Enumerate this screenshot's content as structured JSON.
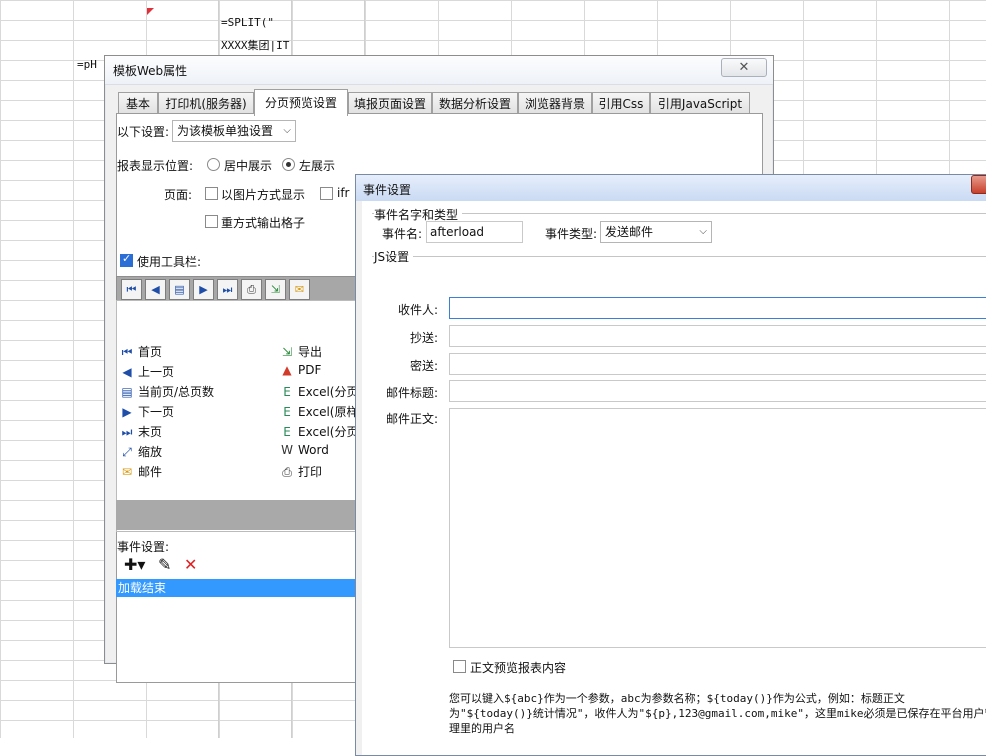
{
  "sheet": {
    "cell_formula": "=SPLIT(\"",
    "cell_group": "XXXX集团|IT",
    "cell_ph": "=pH"
  },
  "web_dialog": {
    "title": "模板Web属性",
    "close_label": "✕",
    "tabs": [
      "基本",
      "打印机(服务器)",
      "分页预览设置",
      "填报页面设置",
      "数据分析设置",
      "浏览器背景",
      "引用Css",
      "引用JavaScript"
    ],
    "settings_label": "以下设置:",
    "settings_value": "为该模板单独设置",
    "position_label": "报表显示位置:",
    "position_center": "居中展示",
    "position_left": "左展示",
    "page_label": "页面:",
    "page_image": "以图片方式显示",
    "page_iframe": "ifr",
    "page_repeat": "重方式输出格子",
    "use_toolbar": "使用工具栏:",
    "toolbar_items_left": [
      {
        "icon": "first-page-icon",
        "glyph": "⏮",
        "label": "首页"
      },
      {
        "icon": "prev-page-icon",
        "glyph": "◀",
        "label": "上一页"
      },
      {
        "icon": "page-count-icon",
        "glyph": "▤",
        "label": "当前页/总页数"
      },
      {
        "icon": "next-page-icon",
        "glyph": "▶",
        "label": "下一页"
      },
      {
        "icon": "last-page-icon",
        "glyph": "⏭",
        "label": "末页"
      },
      {
        "icon": "zoom-icon",
        "glyph": "⤢",
        "label": "缩放"
      },
      {
        "icon": "mail-icon",
        "glyph": "✉",
        "label": "邮件"
      }
    ],
    "toolbar_items_right": [
      {
        "icon": "export-icon",
        "glyph": "⇲",
        "label": "导出"
      },
      {
        "icon": "pdf-icon",
        "glyph": "▲",
        "label": "PDF"
      },
      {
        "icon": "excel-icon",
        "glyph": "E",
        "label": "Excel(分页"
      },
      {
        "icon": "excel-icon",
        "glyph": "E",
        "label": "Excel(原样"
      },
      {
        "icon": "excel-icon",
        "glyph": "E",
        "label": "Excel(分页"
      },
      {
        "icon": "word-icon",
        "glyph": "W",
        "label": "Word"
      },
      {
        "icon": "print-icon",
        "glyph": "⎙",
        "label": "打印"
      }
    ],
    "event_label": "事件设置:",
    "event_selected": "加载结束"
  },
  "event_dialog": {
    "title": "事件设置",
    "group_name": "事件名字和类型",
    "name_label": "事件名:",
    "name_value": "afterload",
    "type_label": "事件类型:",
    "type_value": "发送邮件",
    "js_group": "JS设置",
    "to_label": "收件人:",
    "cc_label": "抄送:",
    "bcc_label": "密送:",
    "subject_label": "邮件标题:",
    "body_label": "邮件正文:",
    "preview_label": "正文预览报表内容",
    "help_line1": "您可以键入${abc}作为一个参数，abc为参数名称；${today()}作为公式，例如：标题正文",
    "help_line2": "为\"${today()}统计情况\"，收件人为\"${p},123@gmail.com,mike\"，这里mike必须是已保存在平台用户管",
    "help_line3": "理里的用户名"
  }
}
